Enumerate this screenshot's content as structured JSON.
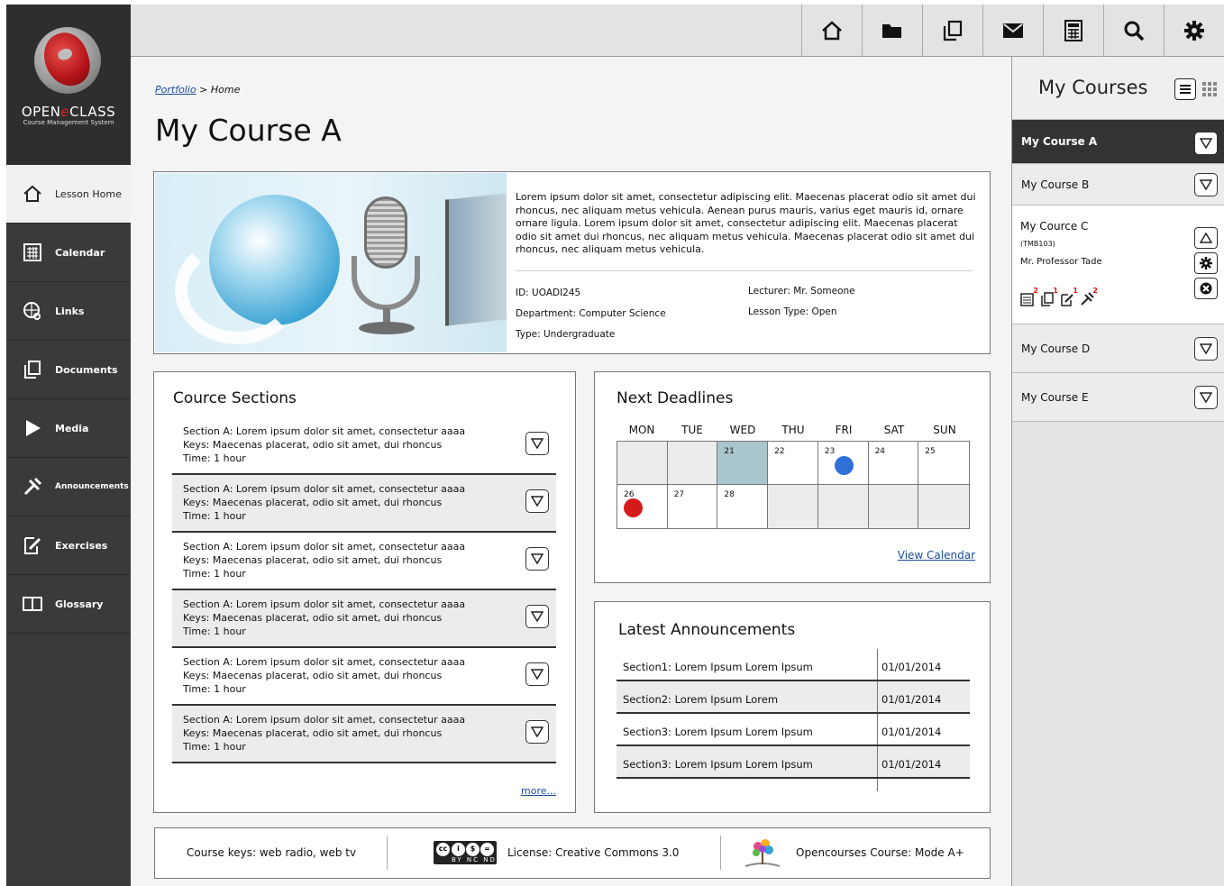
{
  "logo": {
    "brand_prefix": "OPEN",
    "brand_e": "e",
    "brand_suffix": "CLASS",
    "subtitle": "Course Management System"
  },
  "sidebar": {
    "items": [
      {
        "label": "Lesson Home",
        "icon": "home-icon"
      },
      {
        "label": "Calendar",
        "icon": "calendar-icon"
      },
      {
        "label": "Links",
        "icon": "links-icon"
      },
      {
        "label": "Documents",
        "icon": "documents-icon"
      },
      {
        "label": "Media",
        "icon": "media-play-icon"
      },
      {
        "label": "Announcements",
        "icon": "announcements-icon"
      },
      {
        "label": "Exercises",
        "icon": "exercises-icon"
      },
      {
        "label": "Glossary",
        "icon": "glossary-book-icon"
      }
    ]
  },
  "topbar": {
    "icons": [
      "home-icon",
      "folder-icon",
      "copy-icon",
      "mail-icon",
      "calculator-icon",
      "search-icon",
      "gear-icon"
    ]
  },
  "breadcrumb": {
    "parent": "Portfolio",
    "separator": ">",
    "current": "Home"
  },
  "page_title": "My Course A",
  "hero": {
    "description": "Lorem ipsum dolor sit amet, consectetur adipiscing elit. Maecenas placerat odio sit amet dui rhoncus, nec aliquam metus vehicula. Aenean purus mauris, varius eget mauris id, ornare ornare ligula. Lorem ipsum dolor sit amet, consectetur adipiscing elit. Maecenas placerat odio sit amet dui rhoncus, nec aliquam metus vehicula. Maecenas placerat odio sit amet dui rhoncus, nec aliquam metus vehicula.",
    "id": "ID: UOADI245",
    "department": "Department: Computer Science",
    "type": "Type: Undergraduate",
    "lecturer": "Lecturer: Mr. Someone",
    "lesson_type": "Lesson Type: Open"
  },
  "sections": {
    "title": "Cource Sections",
    "rows": [
      {
        "line1": "Section A: Lorem ipsum dolor sit amet, consectetur aaaa",
        "line2": "Keys: Maecenas placerat, odio sit amet, dui rhoncus",
        "line3": "Time: 1 hour"
      },
      {
        "line1": "Section A: Lorem ipsum dolor sit amet, consectetur aaaa",
        "line2": "Keys: Maecenas placerat, odio sit amet, dui rhoncus",
        "line3": "Time: 1 hour"
      },
      {
        "line1": "Section A: Lorem ipsum dolor sit amet, consectetur aaaa",
        "line2": "Keys: Maecenas placerat, odio sit amet, dui rhoncus",
        "line3": "Time: 1 hour"
      },
      {
        "line1": "Section A: Lorem ipsum dolor sit amet, consectetur aaaa",
        "line2": "Keys: Maecenas placerat, odio sit amet, dui rhoncus",
        "line3": "Time: 1 hour"
      },
      {
        "line1": "Section A: Lorem ipsum dolor sit amet, consectetur aaaa",
        "line2": "Keys: Maecenas placerat, odio sit amet, dui rhoncus",
        "line3": "Time: 1 hour"
      },
      {
        "line1": "Section A: Lorem ipsum dolor sit amet, consectetur aaaa",
        "line2": "Keys: Maecenas placerat, odio sit amet, dui rhoncus",
        "line3": "Time: 1 hour"
      }
    ],
    "more": "more..."
  },
  "deadlines": {
    "title": "Next Deadlines",
    "days": [
      "MON",
      "TUE",
      "WED",
      "THU",
      "FRI",
      "SAT",
      "SUN"
    ],
    "cells": [
      {
        "day": "",
        "state": "empty"
      },
      {
        "day": "",
        "state": "empty"
      },
      {
        "day": "21",
        "state": "today"
      },
      {
        "day": "22",
        "state": "normal"
      },
      {
        "day": "23",
        "state": "normal",
        "dot": "#2f6fd8"
      },
      {
        "day": "24",
        "state": "normal"
      },
      {
        "day": "25",
        "state": "normal"
      },
      {
        "day": "26",
        "state": "normal",
        "dot": "#d41a1a"
      },
      {
        "day": "27",
        "state": "normal"
      },
      {
        "day": "28",
        "state": "normal"
      },
      {
        "day": "",
        "state": "empty"
      },
      {
        "day": "",
        "state": "empty"
      },
      {
        "day": "",
        "state": "empty"
      },
      {
        "day": "",
        "state": "empty"
      }
    ],
    "view_calendar": "View Calendar"
  },
  "announcements": {
    "title": "Latest Announcements",
    "rows": [
      {
        "text": "Section1: Lorem Ipsum Lorem Ipsum",
        "date": "01/01/2014"
      },
      {
        "text": "Section2: Lorem Ipsum Lorem",
        "date": "01/01/2014"
      },
      {
        "text": "Section3: Lorem Ipsum Lorem Ipsum",
        "date": "01/01/2014"
      },
      {
        "text": "Section3: Lorem Ipsum Lorem Ipsum",
        "date": "01/01/2014"
      }
    ]
  },
  "footer": {
    "keys": "Course keys: web radio, web tv",
    "license": "License: Creative Commons 3.0",
    "opencourses": "Opencourses Course: Mode A+",
    "cc_badge_text": "BY NC ND"
  },
  "right_sidebar": {
    "title": "My Courses",
    "courses": [
      {
        "name": "My Course A",
        "active": true
      },
      {
        "name": "My Course B"
      },
      {
        "name": "My Cource C",
        "code": "(TMB103)",
        "professor": "Mr. Professor Tade",
        "expanded": true,
        "badges": [
          "2",
          "1",
          "1",
          "2"
        ]
      },
      {
        "name": "My Course D"
      },
      {
        "name": "My Course E"
      }
    ]
  },
  "colors": {
    "sidebar_bg": "#3a3a3a",
    "link": "#1a4c9c",
    "today_cell": "#a9c6cc",
    "deadline_blue": "#2f6fd8",
    "deadline_red": "#d41a1a"
  }
}
